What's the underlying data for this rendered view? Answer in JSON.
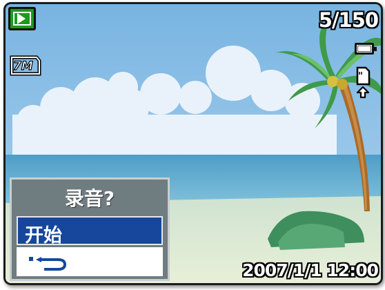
{
  "status": {
    "mode_icon": "play-icon",
    "resolution_label": "7M",
    "counter": "5/150",
    "battery_icon": "battery-icon",
    "memory_icon": "sd-card-icon"
  },
  "dialog": {
    "title": "录音?",
    "options": [
      {
        "label": "开始",
        "selected": true
      },
      {
        "label": "",
        "icon": "return-arrow-icon",
        "selected": false
      }
    ]
  },
  "datetime": "2007/1/1 12:00",
  "colors": {
    "play_badge": "#1a9c1a",
    "dialog_bg": "#6f7c80",
    "selected_option": "#16479c",
    "sky": "#8fc0e4",
    "sea": "#5aa8cc"
  }
}
